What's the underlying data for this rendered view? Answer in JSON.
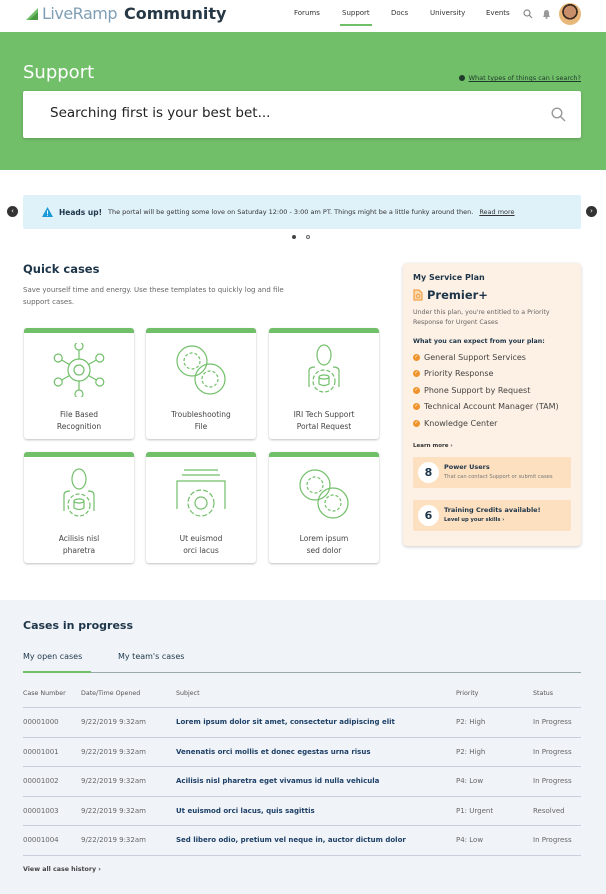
{
  "nav": {
    "brand": "LiveRamp",
    "brand_suffix": "Community",
    "links": [
      "Forums",
      "Support",
      "Docs",
      "University",
      "Events"
    ],
    "active": "Support",
    "icons": [
      "search-icon",
      "bell-icon",
      "avatar"
    ]
  },
  "hero": {
    "title": "Support",
    "help_link": "What types of things can I search?",
    "search_placeholder": "Searching first is your best bet...",
    "bg_color": "#72bf6a"
  },
  "alert": {
    "title": "Heads up!",
    "message": "The portal will be getting some love on Saturday 12:00 - 3:00 am PT. Things might be a little funky around then.",
    "link": "Read more",
    "slide": 1,
    "slides": 2
  },
  "quick_cases": {
    "title": "Quick cases",
    "description": "Save yourself time and energy. Use these templates to quickly log and file support cases.",
    "cards": [
      {
        "l1": "File Based",
        "l2": "Recognition",
        "icon": "network-gear-icon"
      },
      {
        "l1": "Troubleshooting",
        "l2": "File",
        "icon": "gears-cycle-icon"
      },
      {
        "l1": "IRI Tech Support",
        "l2": "Portal Request",
        "icon": "person-database-icon"
      },
      {
        "l1": "Acilisis nisl",
        "l2": "pharetra",
        "icon": "person-database-icon"
      },
      {
        "l1": "Ut euismod",
        "l2": "orci lacus",
        "icon": "window-gear-icon"
      },
      {
        "l1": "Lorem ipsum",
        "l2": "sed dolor",
        "icon": "gears-cycle-icon"
      }
    ]
  },
  "plan": {
    "heading": "My Service Plan",
    "tier": "Premier+",
    "description": "Under this plan, you're entitled to a Priority Response for Urgent Cases",
    "expect": "What you can expect from your plan:",
    "features": [
      "General Support Services",
      "Priority Response",
      "Phone Support by Request",
      "Technical Account Manager (TAM)",
      "Knowledge Center"
    ],
    "learn_more": "Learn more ›",
    "power_users": {
      "count": "8",
      "title": "Power Users",
      "sub": "That can contact Support or submit cases"
    },
    "training": {
      "count": "6",
      "title": "Training Credits available!",
      "sub": "Level up your skills ›"
    }
  },
  "cases": {
    "title": "Cases in progress",
    "tabs": [
      "My open cases",
      "My team's cases"
    ],
    "active_tab": 0,
    "columns": [
      "Case Number",
      "Date/Time Opened",
      "Subject",
      "Priority",
      "Status"
    ],
    "rows": [
      [
        "00001000",
        "9/22/2019 9:32am",
        "Lorem ipsum dolor sit amet, consectetur adipiscing elit",
        "P2: High",
        "In Progress"
      ],
      [
        "00001001",
        "9/22/2019 9:32am",
        "Venenatis orci mollis et donec egestas urna risus",
        "P2: High",
        "In Progress"
      ],
      [
        "00001002",
        "9/22/2019 9:32am",
        "Acilisis nisl pharetra eget vivamus id nulla vehicula",
        "P4: Low",
        "In Progress"
      ],
      [
        "00001003",
        "9/22/2019 9:32am",
        "Ut euismod orci lacus, quis sagittis",
        "P1: Urgent",
        "Resolved"
      ],
      [
        "00001004",
        "9/22/2019 9:32am",
        "Sed libero odio, pretium vel neque in, auctor dictum dolor",
        "P4: Low",
        "In Progress"
      ]
    ],
    "view_all": "View all case history ›"
  }
}
